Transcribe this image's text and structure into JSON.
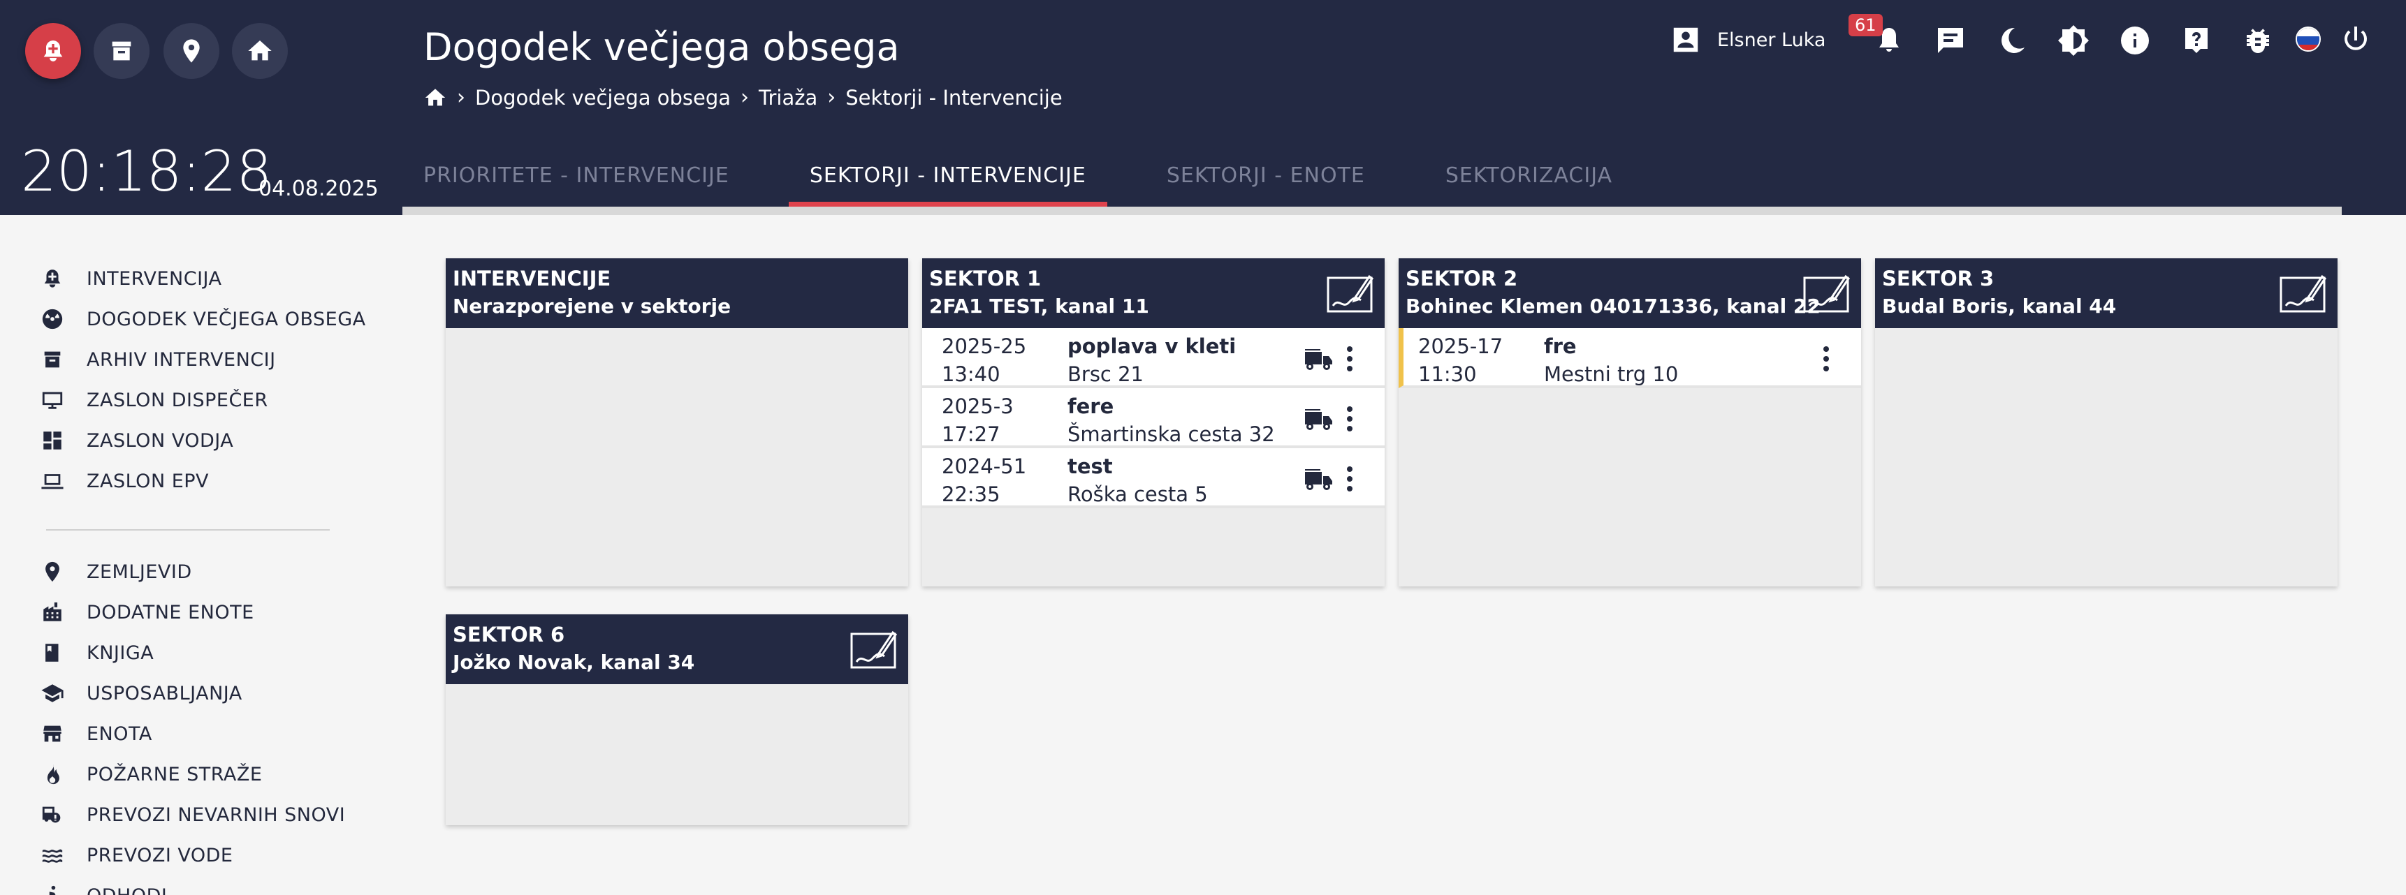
{
  "header": {
    "title": "Dogodek večjega obsega",
    "breadcrumb": [
      "Dogodek večjega obsega",
      "Triaža",
      "Sektorji - Intervencije"
    ],
    "clock": "20:18:28",
    "date": "04.08.2025",
    "tabs": [
      "PRIORITETE - INTERVENCIJE",
      "SEKTORJI - INTERVENCIJE",
      "SEKTORJI - ENOTE",
      "SEKTORIZACIJA"
    ],
    "active_tab": "SEKTORJI - INTERVENCIJE",
    "user_name": "Elsner Luka",
    "notification_count": "61",
    "accent_color": "#e0434d",
    "header_color": "#232943"
  },
  "sidebar": {
    "group1": [
      "INTERVENCIJA",
      "DOGODEK VEČJEGA OBSEGA",
      "ARHIV INTERVENCIJ",
      "ZASLON DISPEČER",
      "ZASLON VODJA",
      "ZASLON EPV"
    ],
    "group2": [
      "ZEMLJEVID",
      "DODATNE ENOTE",
      "KNJIGA",
      "USPOSABLJANJA",
      "ENOTA",
      "POŽARNE STRAŽE",
      "PREVOZI NEVARNIH SNOVI",
      "PREVOZI VODE",
      "ODHODI"
    ]
  },
  "panels": [
    {
      "title": "INTERVENCIJE",
      "subtitle": "Nerazporejene v sektorje",
      "rows": []
    },
    {
      "title": "SEKTOR 1",
      "subtitle": "2FA1 TEST, kanal 11",
      "rows": [
        {
          "code": "2025-25",
          "time": "13:40",
          "name": "poplava v kleti",
          "address": "Brsc 21"
        },
        {
          "code": "2025-3",
          "time": "17:27",
          "name": "fere",
          "address": "Šmartinska cesta 32"
        },
        {
          "code": "2024-51",
          "time": "22:35",
          "name": "test",
          "address": "Roška cesta 5"
        }
      ]
    },
    {
      "title": "SEKTOR 2",
      "subtitle": "Bohinec Klemen 040171336, kanal 22",
      "rows": [
        {
          "code": "2025-17",
          "time": "11:30",
          "name": "fre",
          "address": "Mestni trg 10"
        }
      ]
    },
    {
      "title": "SEKTOR 3",
      "subtitle": "Budal Boris, kanal 44",
      "rows": []
    },
    {
      "title": "SEKTOR 6",
      "subtitle": "Jožko Novak, kanal 34",
      "rows": []
    }
  ]
}
